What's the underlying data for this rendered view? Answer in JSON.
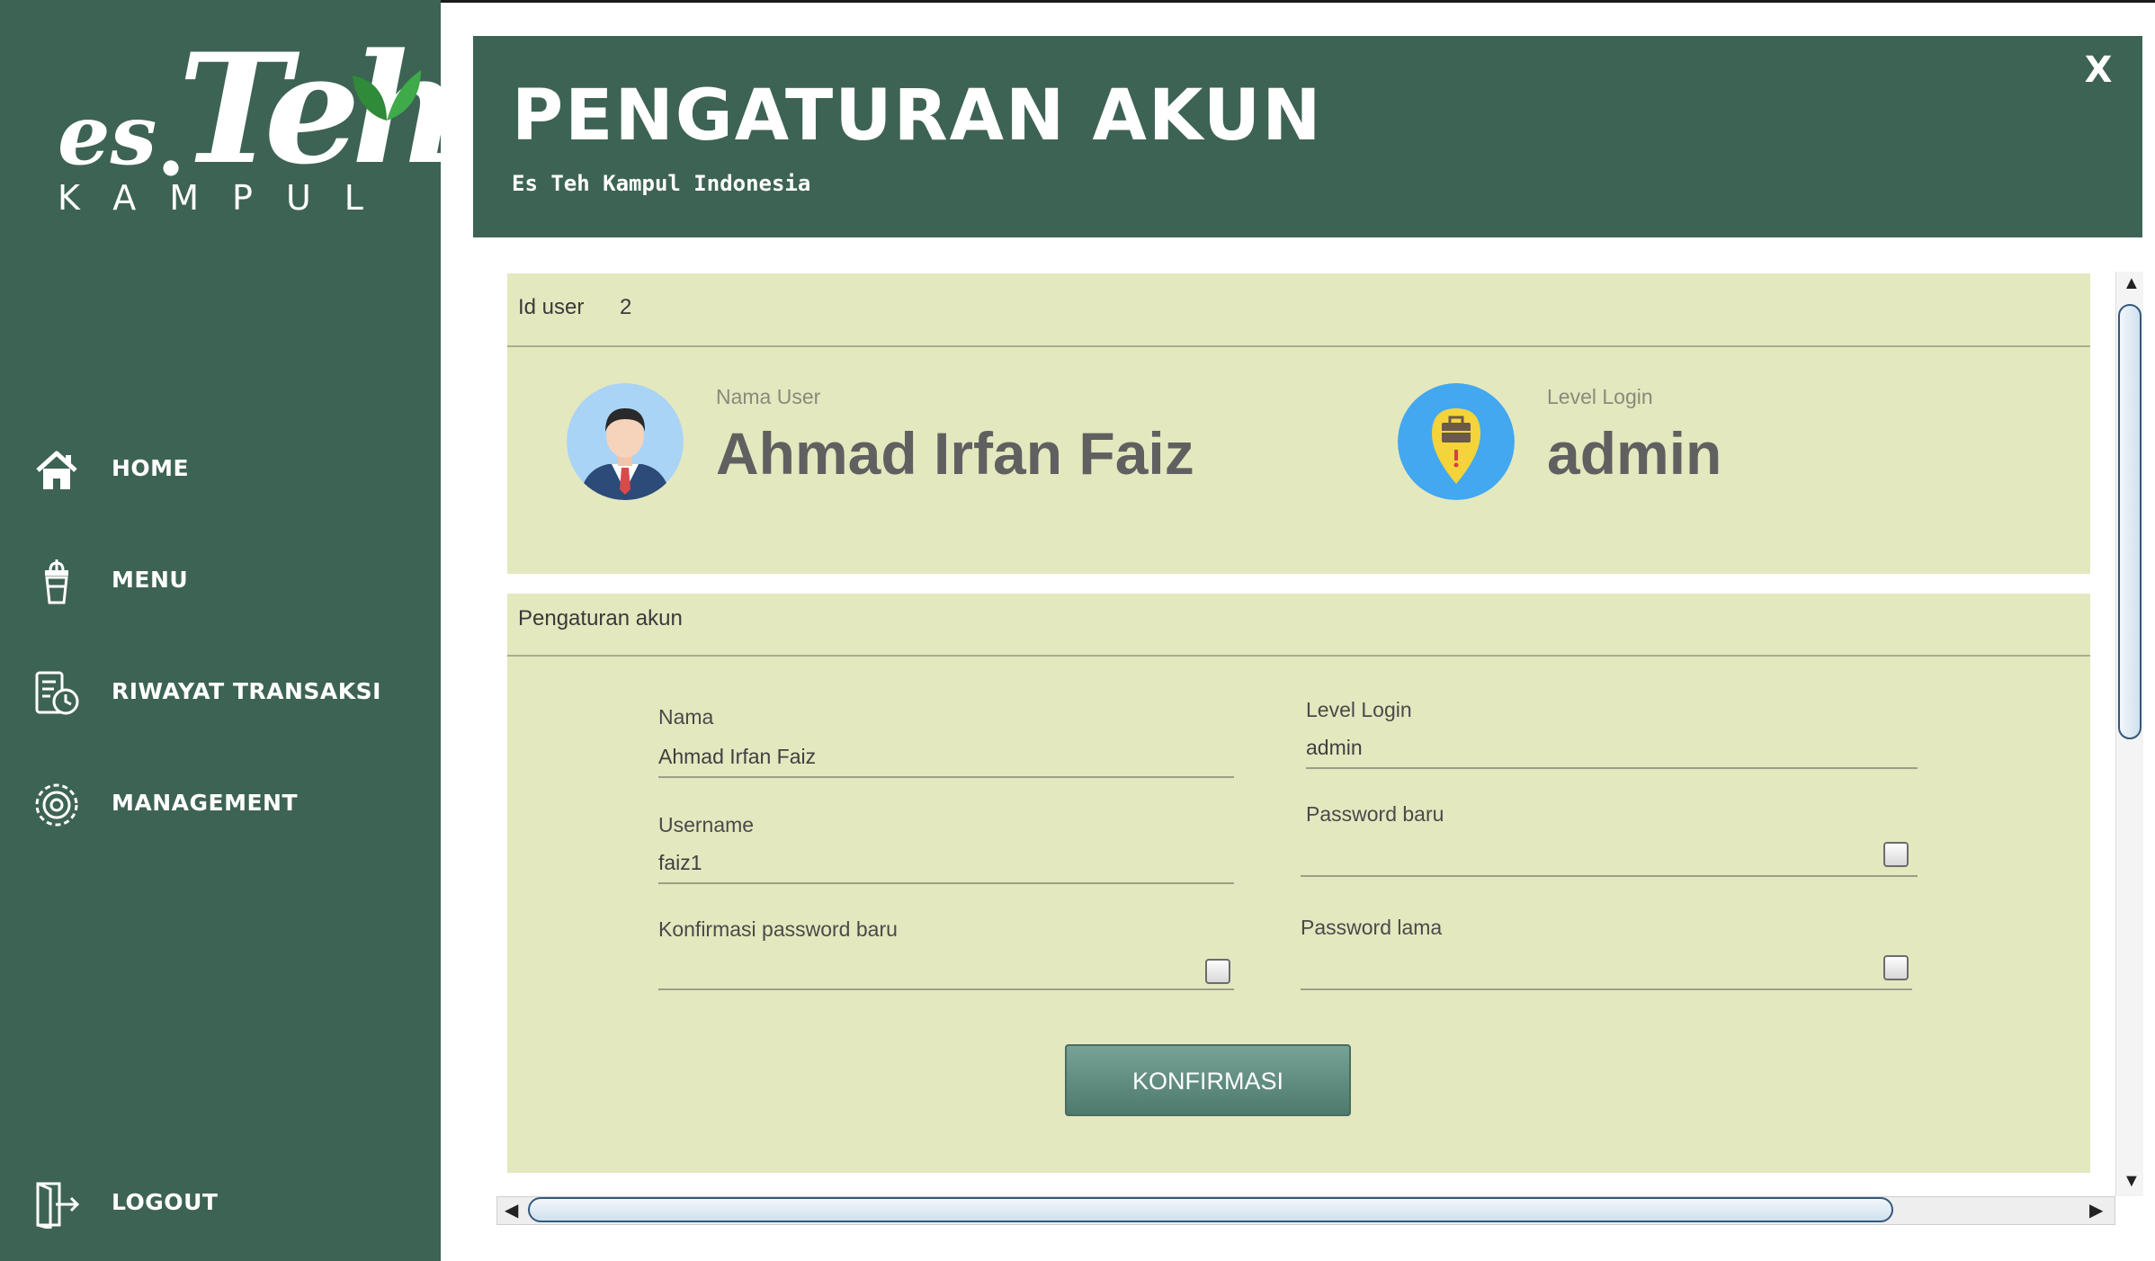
{
  "sidebar": {
    "logo": {
      "es": "es",
      "dot": ".",
      "teh": "Teh",
      "kampul": "KAMPUL"
    },
    "items": [
      {
        "label": "HOME",
        "icon": "home-icon"
      },
      {
        "label": "MENU",
        "icon": "drink-cup-icon"
      },
      {
        "label": "RIWAYAT TRANSAKSI",
        "icon": "history-icon"
      },
      {
        "label": "MANAGEMENT",
        "icon": "gear-icon"
      }
    ],
    "logout": {
      "label": "LOGOUT",
      "icon": "logout-icon"
    }
  },
  "header": {
    "title": "PENGATURAN AKUN",
    "subtitle": "Es Teh Kampul Indonesia",
    "close_label": "X"
  },
  "profile": {
    "id_label": "Id user",
    "id_value": "2",
    "name_label": "Nama User",
    "name_value": "Ahmad Irfan Faiz",
    "level_label": "Level Login",
    "level_value": "admin"
  },
  "settings": {
    "section_label": "Pengaturan akun",
    "nama_label": "Nama",
    "nama_value": "Ahmad Irfan Faiz",
    "level_label": "Level Login",
    "level_value": "admin",
    "username_label": "Username",
    "username_value": "faiz1",
    "password_baru_label": "Password baru",
    "konfirmasi_label": "Konfirmasi password baru",
    "password_lama_label": "Password lama",
    "button_label": "KONFIRMASI"
  },
  "colors": {
    "sidebar_bg": "#3d6354",
    "header_bg": "#3d6354",
    "panel_bg": "#e4e8bf",
    "button_bg": "#5f8b7e",
    "avatar_bg": "#a9d4f5",
    "level_icon_bg": "#43a8f0"
  }
}
